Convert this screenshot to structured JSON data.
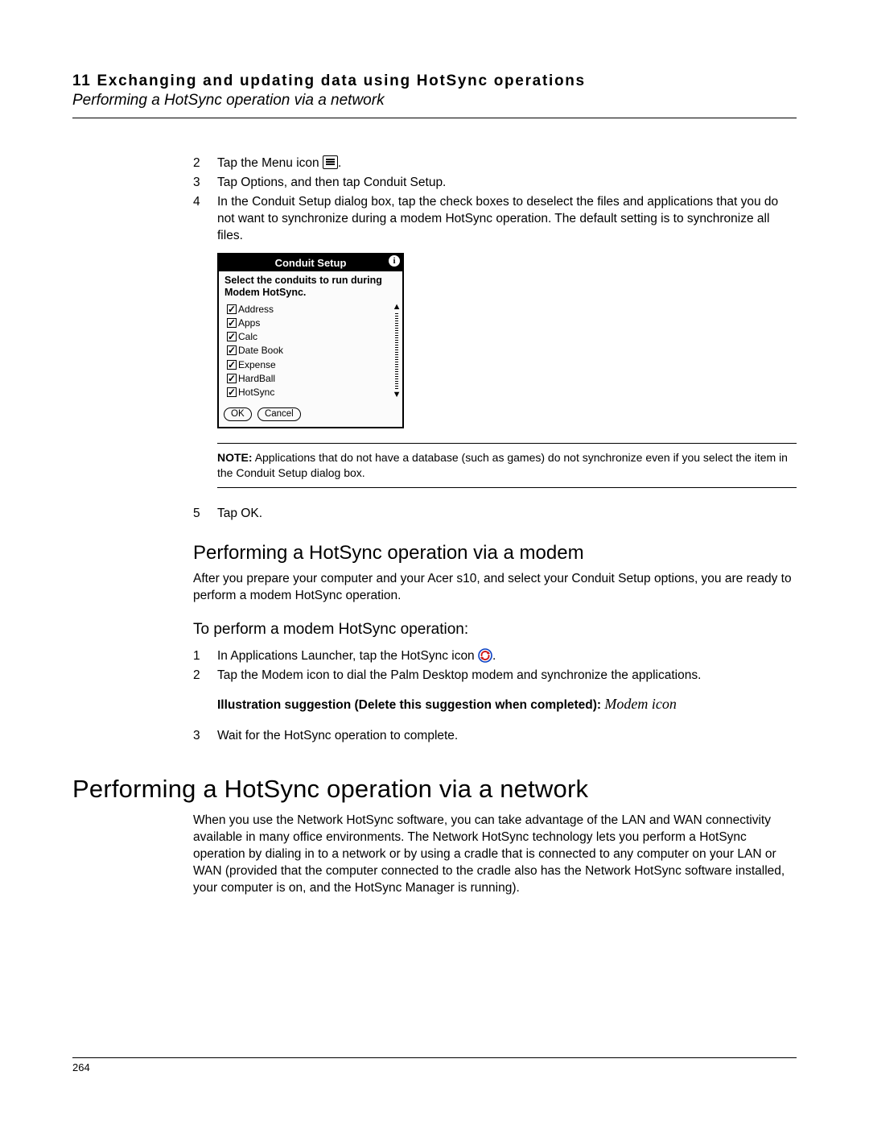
{
  "header": {
    "chapter_line": "11 Exchanging and updating data using HotSync operations",
    "section_line": "Performing a HotSync operation via a network"
  },
  "steps_a": [
    {
      "n": "2",
      "text_before": "Tap the Menu icon ",
      "text_after": "."
    },
    {
      "n": "3",
      "text": "Tap Options, and then tap Conduit Setup."
    },
    {
      "n": "4",
      "text": "In the Conduit Setup dialog box, tap the check boxes to deselect the files and applications that you do not want to synchronize during a modem HotSync operation. The default setting is to synchronize all files."
    }
  ],
  "conduit_dialog": {
    "title": "Conduit Setup",
    "subtitle": "Select the conduits to run during Modem HotSync.",
    "items": [
      "Address",
      "Apps",
      "Calc",
      "Date Book",
      "Expense",
      "HardBall",
      "HotSync"
    ],
    "ok": "OK",
    "cancel": "Cancel"
  },
  "note": {
    "label": "NOTE:",
    "text": "Applications that do not have a database (such as games) do not synchronize even if you select the item in the Conduit Setup dialog box."
  },
  "steps_b": [
    {
      "n": "5",
      "text": "Tap OK."
    }
  ],
  "modem_section": {
    "heading": "Performing a HotSync operation via a modem",
    "intro": "After you prepare your computer and your Acer s10, and select your Conduit Setup options, you are ready to perform a modem HotSync operation.",
    "subheading": "To perform a modem HotSync operation:",
    "steps": [
      {
        "n": "1",
        "text_before": "In Applications Launcher, tap the HotSync icon ",
        "text_after": "."
      },
      {
        "n": "2",
        "text": "Tap the Modem icon to dial the Palm Desktop modem and synchronize the applications."
      }
    ],
    "illustration_bold": "Illustration suggestion (Delete this suggestion when completed):",
    "illustration_italic": "Modem icon",
    "steps2": [
      {
        "n": "3",
        "text": "Wait for the HotSync operation to complete."
      }
    ]
  },
  "network_section": {
    "heading": "Performing a HotSync operation via a network",
    "body": "When you use the Network HotSync software, you can take advantage of the LAN and WAN connectivity available in many office environments. The Network HotSync technology lets you perform a HotSync operation by dialing in to a network or by using a cradle that is connected to any computer on your LAN or WAN (provided that the computer connected to the cradle also has the Network HotSync software installed, your computer is on, and the HotSync Manager is running)."
  },
  "page_number": "264"
}
